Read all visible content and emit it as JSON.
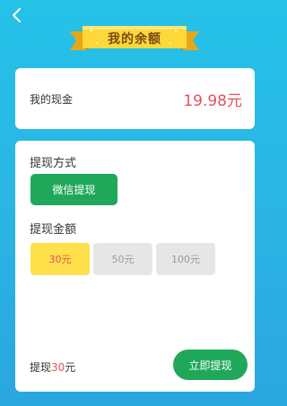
{
  "header": {
    "back_icon": "chevron-left-icon",
    "title": "我的余额"
  },
  "balance": {
    "label": "我的现金",
    "value": "19.98元"
  },
  "withdraw": {
    "method_title": "提现方式",
    "method_option": "微信提现",
    "amount_title": "提现金额",
    "amount_options": [
      {
        "label": "30元",
        "selected": true
      },
      {
        "label": "50元",
        "selected": false
      },
      {
        "label": "100元",
        "selected": false
      }
    ],
    "summary_prefix": "提现",
    "summary_amount": "30",
    "summary_suffix": "元",
    "submit_label": "立即提现"
  },
  "colors": {
    "accent_green": "#1fa85a",
    "price_red": "#e8505b",
    "selected_yellow": "#fde04a",
    "background_blue": "#2ab4e4"
  }
}
